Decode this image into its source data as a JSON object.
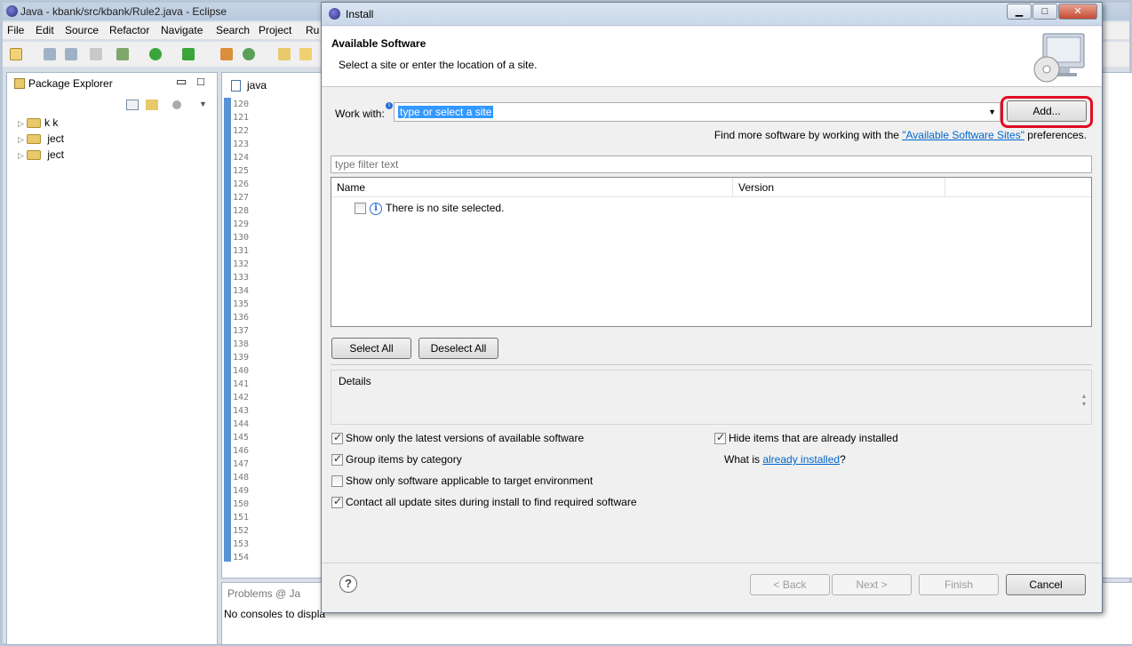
{
  "eclipse": {
    "window_title": "Java - kbank/src/kbank/Rule2.java - Eclipse",
    "menu": [
      "File",
      "Edit",
      "Source",
      "Refactor",
      "Navigate",
      "Search",
      "Project",
      "Ru"
    ],
    "package_explorer": {
      "title": "Package Explorer",
      "items": [
        "k    k",
        "     ject",
        "              ject"
      ]
    },
    "editor": {
      "tab_label": "      java",
      "line_numbers": [
        "120",
        "121",
        "122",
        "123",
        "124",
        "125",
        "126",
        "127",
        "128",
        "129",
        "130",
        "131",
        "132",
        "133",
        "134",
        "135",
        "136",
        "137",
        "138",
        "139",
        "140",
        "141",
        "142",
        "143",
        "144",
        "145",
        "146",
        "147",
        "148",
        "149",
        "150",
        "151",
        "152",
        "153",
        "154"
      ]
    },
    "bottom_panel": {
      "tabs": "Problems  @ Ja",
      "message": "No consoles to displa"
    }
  },
  "dialog": {
    "title": "Install",
    "header_title": "Available Software",
    "header_desc": "Select a site or enter the location of a site.",
    "work_with_label": "Work with:",
    "work_with_value": "type or select a site",
    "add_button": "Add...",
    "find_more_prefix": "Find more software by working with the ",
    "find_more_link": "\"Available Software Sites\"",
    "find_more_suffix": " preferences.",
    "filter_placeholder": "type filter text",
    "table": {
      "columns": [
        "Name",
        "Version"
      ],
      "empty_message": "There is no site selected."
    },
    "select_all": "Select All",
    "deselect_all": "Deselect All",
    "details_label": "Details",
    "options": {
      "latest_versions": {
        "label": "Show only the latest versions of available software",
        "checked": true
      },
      "group_by_category": {
        "label": "Group items by category",
        "checked": true
      },
      "target_environment": {
        "label": "Show only software applicable to target environment",
        "checked": false
      },
      "contact_update_sites": {
        "label": "Contact all update sites during install to find required software",
        "checked": true
      },
      "hide_installed": {
        "label": "Hide items that are already installed",
        "checked": true
      }
    },
    "what_is_prefix": "What is ",
    "what_is_link": "already installed",
    "what_is_suffix": "?",
    "buttons": {
      "back": "< Back",
      "next": "Next >",
      "finish": "Finish",
      "cancel": "Cancel"
    }
  },
  "colors": {
    "highlight_ring": "#e10c24",
    "link": "#0066cc",
    "selection": "#3399ff"
  }
}
